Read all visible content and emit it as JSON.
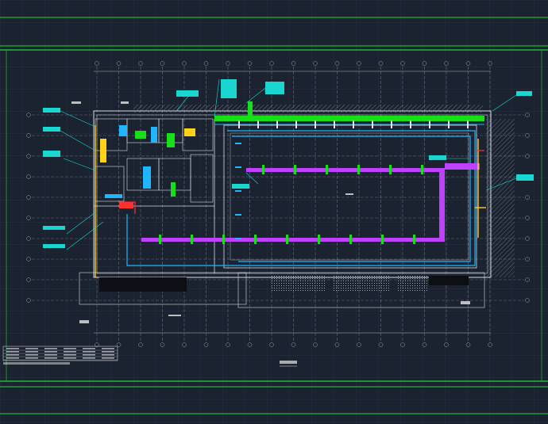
{
  "drawing": {
    "type": "cad-floor-plan",
    "colors": {
      "background": "#1b2230",
      "grid": "#2c3646",
      "frame": "#22d43a",
      "wall": "#d7dbe2",
      "axis": "#9aa3ad",
      "duct_supply": "#c040ff",
      "duct_return": "#1fb6ff",
      "pipe_green": "#18e018",
      "pipe_yellow": "#ffd21a",
      "pipe_red": "#ff3030",
      "callout": "#19d7d0",
      "hatch": "#8a929c"
    },
    "annotations": [],
    "legend_rows": 4,
    "notes": []
  }
}
